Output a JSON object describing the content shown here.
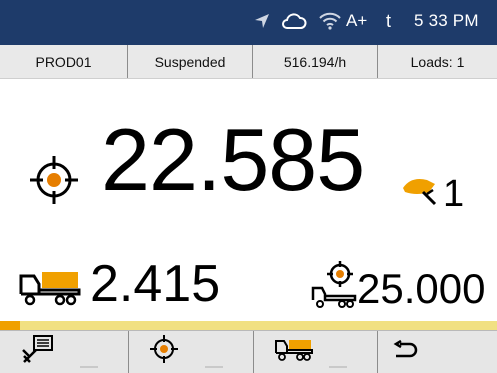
{
  "status_bar": {
    "time": "5 33 PM",
    "network_label": "A+",
    "carrier_char": "t",
    "icons": [
      "navigation-arrow-icon",
      "cloud-icon",
      "wifi-icon"
    ]
  },
  "info_bar": {
    "product": "PROD01",
    "status": "Suspended",
    "rate": "516.194/h",
    "loads": "Loads: 1"
  },
  "main": {
    "weight": "22.585",
    "bucket_count": "1"
  },
  "secondary": {
    "truck_load": "2.415",
    "target_load": "25.000"
  },
  "progress": {
    "fraction": 0.04,
    "fill_color": "#f0a000",
    "track_color": "#f1e082"
  },
  "toolbar": {
    "buttons": [
      "settings-tools-icon",
      "target-icon",
      "truck-load-icon",
      "back-return-icon"
    ]
  },
  "colors": {
    "status_bar_bg": "#1e3b6a",
    "accent_orange": "#f0a000"
  }
}
